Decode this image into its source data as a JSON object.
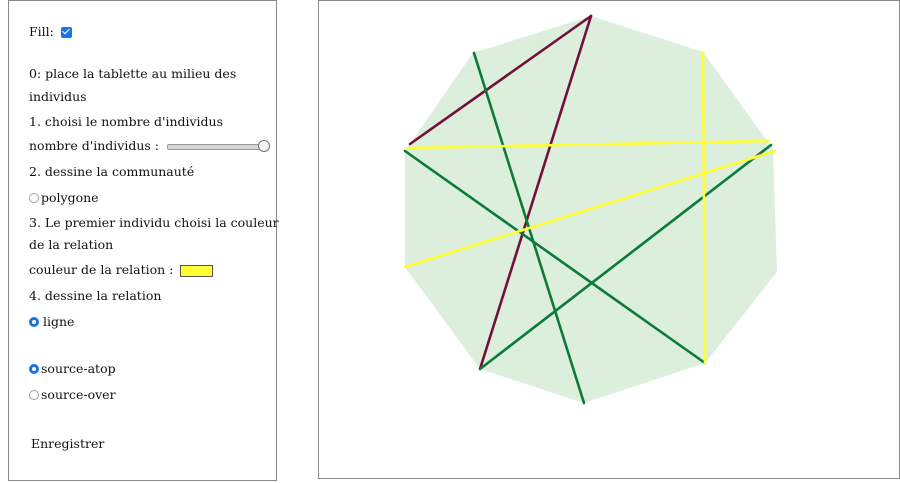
{
  "controls": {
    "fill_label": "Fill:",
    "fill_checked": true,
    "step0": "0: place la tablette au milieu des",
    "step0_cont": "individus",
    "step1": "1. choisi le nombre d'individus",
    "slider_label": "nombre d'individus :",
    "step2": "2. dessine la communauté",
    "polygone_label": "polygone",
    "step3": "3. Le premier individu choisi la couleur",
    "step3_cont": "de la relation",
    "color_label": "couleur de la relation :",
    "relation_color": "#ffff33",
    "step4": "4. dessine la relation",
    "ligne_label": "ligne",
    "atop_label": "source-atop",
    "over_label": "source-over",
    "save_label": "Enregistrer"
  },
  "canvas": {
    "polygon_fill": "#dcefdd",
    "line_colors": {
      "maroon": "#73103a",
      "green": "#0d7a3a",
      "yellow": "#ffff33"
    }
  }
}
